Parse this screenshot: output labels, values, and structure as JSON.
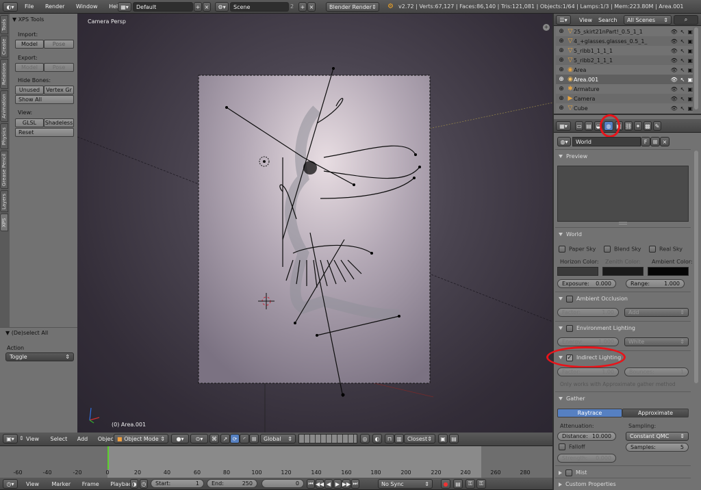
{
  "topbar": {
    "menus": [
      "File",
      "Render",
      "Window",
      "Help"
    ],
    "layout": "Default",
    "scene": "Scene",
    "scene_users": "2",
    "engine": "Blender Render",
    "stats": "v2.72 | Verts:67,127 | Faces:86,140 | Tris:121,081 | Objects:1/64 | Lamps:1/3 | Mem:223.80M | Area.001"
  },
  "toolshelf": {
    "tabs": [
      "Tools",
      "Create",
      "Relations",
      "Animation",
      "Physics",
      "Grease Pencil",
      "Layers",
      "XPS"
    ],
    "title": "XPS Tools",
    "import_label": "Import:",
    "model_btn": "Model",
    "pose_btn": "Pose",
    "export_label": "Export:",
    "model_btn2": "Model",
    "pose_btn2": "Pose",
    "hide_bones_label": "Hide Bones:",
    "unused_btn": "Unused",
    "vertex_btn": "Vertex Gr",
    "show_all_btn": "Show All",
    "view_label": "View:",
    "glsl_btn": "GLSL",
    "shadeless_btn": "Shadeless",
    "reset_btn": "Reset",
    "operator_title": "(De)select All",
    "action_label": "Action",
    "action_value": "Toggle"
  },
  "viewport": {
    "label": "Camera Persp",
    "object_label": "(0) Area.001"
  },
  "viewport_header": {
    "menus": [
      "View",
      "Select",
      "Add",
      "Object"
    ],
    "mode": "Object Mode",
    "orientation": "Global",
    "snap": "Closest"
  },
  "outliner": {
    "header_items": [
      "View",
      "Search"
    ],
    "scenes": "All Scenes",
    "rows": [
      "25_skirt21nPart!_0.5_1_1",
      "4_+glasses.glasses_0.5_1_1",
      "5_ribb1_1_1_1",
      "5_ribb2_1_1_1",
      "Area",
      "Area.001",
      "Armature",
      "Camera",
      "Cube"
    ]
  },
  "properties": {
    "world_name": "World",
    "fake_user": "F",
    "preview_title": "Preview",
    "world_title": "World",
    "paper_sky": "Paper Sky",
    "blend_sky": "Blend Sky",
    "real_sky": "Real Sky",
    "horizon_color": "Horizon Color:",
    "zenith_color": "Zenith Color:",
    "ambient_color": "Ambient Color:",
    "exposure_label": "Exposure:",
    "exposure_value": "0.000",
    "range_label": "Range:",
    "range_value": "1.000",
    "ao_title": "Ambient Occlusion",
    "factor_label": "Factor:",
    "ao_factor": "1.00",
    "ao_blend": "Add",
    "env_title": "Environment Lighting",
    "env_energy_label": "Energy:",
    "env_energy": "1.000",
    "env_color": "White",
    "indirect_title": "Indirect Lighting",
    "indirect_factor": "1.00",
    "bounces_label": "Bounces:",
    "bounces_value": "1",
    "indirect_note": "Only works with Approximate gather method",
    "gather_title": "Gather",
    "raytrace": "Raytrace",
    "approximate": "Approximate",
    "attenuation_label": "Attenuation:",
    "sampling_label": "Sampling:",
    "distance_label": "Distance:",
    "distance_value": "10.000",
    "sampling_value": "Constant QMC",
    "falloff": "Falloff",
    "samples_label": "Samples:",
    "samples_value": "5",
    "strength_label": "Strength:",
    "strength_value": "0.000",
    "mist_title": "Mist",
    "custom_title": "Custom Properties"
  },
  "timeline": {
    "ticks": [
      "-60",
      "-40",
      "-20",
      "0",
      "20",
      "40",
      "60",
      "80",
      "100",
      "120",
      "140",
      "160",
      "180",
      "200",
      "220",
      "240",
      "260",
      "280"
    ],
    "menus": [
      "View",
      "Marker",
      "Frame",
      "Playback"
    ],
    "start_label": "Start:",
    "start_value": "1",
    "end_label": "End:",
    "end_value": "250",
    "current_frame": "0",
    "sync": "No Sync"
  },
  "colors": {
    "accent": "#5680c2",
    "highlight": "#e8141a",
    "viewport_bg": "#3a3340"
  }
}
